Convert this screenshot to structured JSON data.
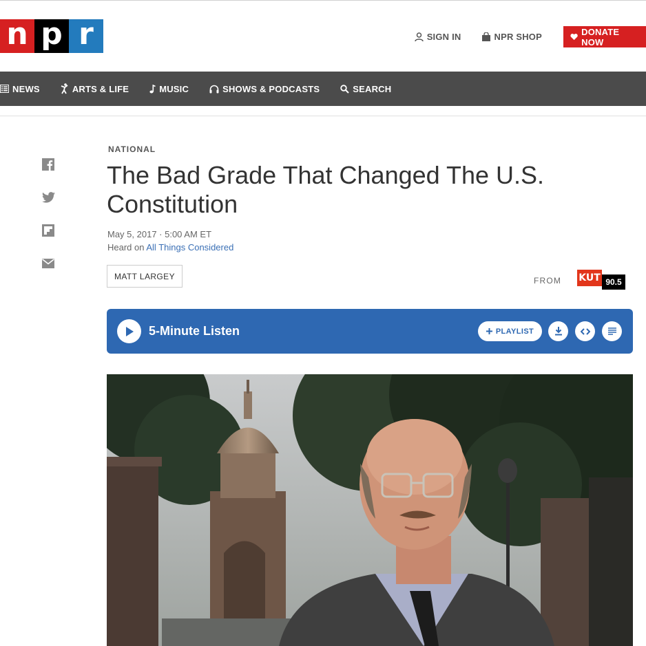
{
  "brand": {
    "letters": [
      "n",
      "p",
      "r"
    ]
  },
  "utility": {
    "sign_in": "SIGN IN",
    "shop": "NPR SHOP",
    "donate": "DONATE NOW"
  },
  "nav": [
    {
      "label": "NEWS",
      "icon": "news-icon"
    },
    {
      "label": "ARTS & LIFE",
      "icon": "arts-icon"
    },
    {
      "label": "MUSIC",
      "icon": "music-note-icon"
    },
    {
      "label": "SHOWS & PODCASTS",
      "icon": "headphones-icon"
    },
    {
      "label": "SEARCH",
      "icon": "search-icon"
    }
  ],
  "share": [
    "facebook-icon",
    "twitter-icon",
    "flipboard-icon",
    "email-icon"
  ],
  "article": {
    "slug": "NATIONAL",
    "title": "The Bad Grade That Changed The U.S. Constitution",
    "date": "May 5, 2017 · 5:00 AM ET",
    "heard_prefix": "Heard on ",
    "heard_program": "All Things Considered",
    "author": "MATT LARGEY",
    "from": "FROM",
    "station": {
      "name": "KUT",
      "freq": "90.5"
    }
  },
  "player": {
    "label": "5-Minute Listen",
    "playlist": "PLAYLIST"
  },
  "colors": {
    "npr_red": "#d62021",
    "npr_blue": "#237bbd",
    "nav_bg": "#4b4b4b",
    "player_bg": "#2e68b2",
    "link": "#3a6fb5"
  }
}
